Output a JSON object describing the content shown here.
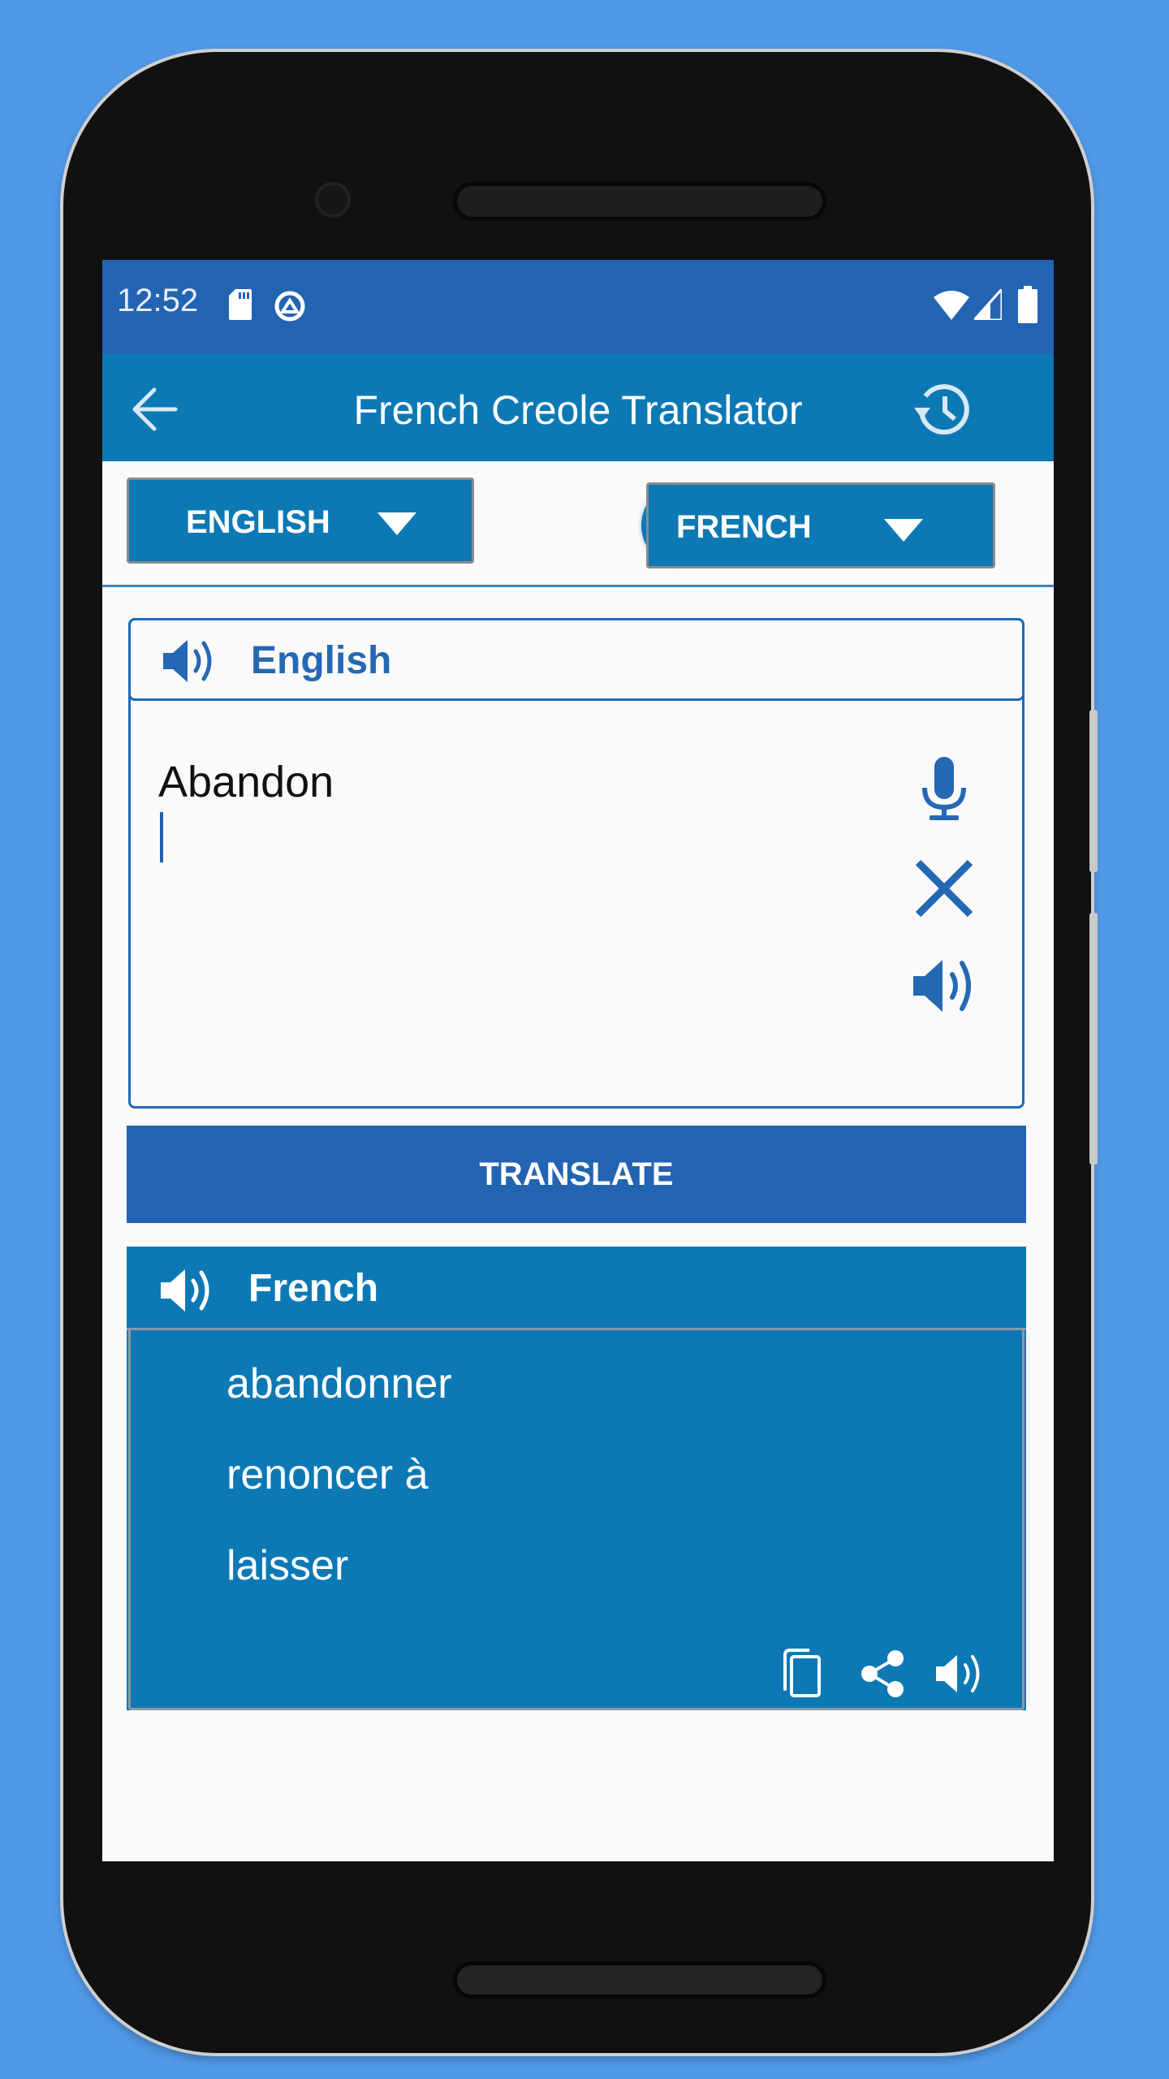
{
  "status_bar": {
    "time": "12:52",
    "left_icons": [
      "sd-card-icon",
      "data-saver-icon"
    ],
    "right_icons": [
      "wifi-icon",
      "signal-icon",
      "battery-icon"
    ]
  },
  "app_bar": {
    "title": "French Creole Translator",
    "back_icon": "arrow-back-icon",
    "history_icon": "history-icon"
  },
  "language_row": {
    "source_language": "ENGLISH",
    "target_language": "FRENCH",
    "swap_icon": "swap-icon"
  },
  "input_card": {
    "title": "English",
    "text": "Abandon",
    "actions": [
      "microphone-icon",
      "clear-icon",
      "speaker-icon"
    ]
  },
  "translate_button": {
    "label": "TRANSLATE"
  },
  "output_card": {
    "title": "French",
    "results": [
      "abandonner",
      "renoncer à",
      "laisser"
    ],
    "actions": [
      "copy-icon",
      "share-icon",
      "speaker-icon"
    ]
  },
  "colors": {
    "background": "#5199e8",
    "status_bar": "#2364b2",
    "primary": "#0c79b5",
    "accent": "#1f6ab8"
  }
}
